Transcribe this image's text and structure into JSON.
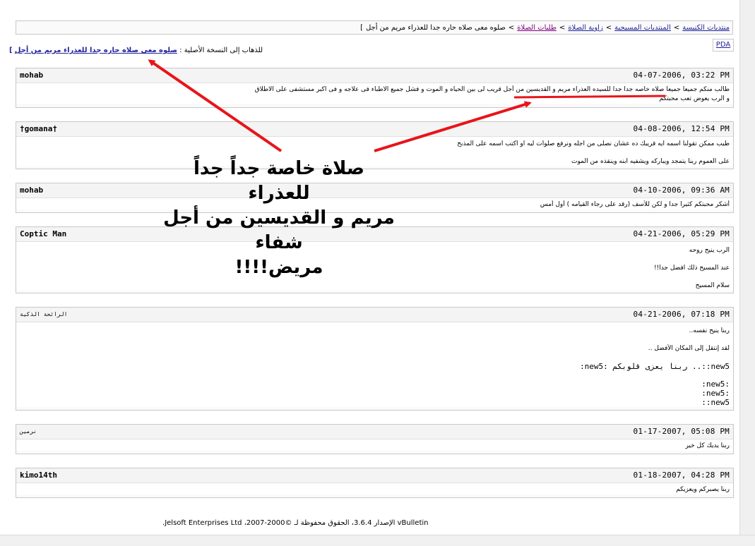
{
  "navbar": {
    "crumbs": [
      "منتديات الكنيسة",
      "المنتديات المسيحية",
      "زاوية الصلاة",
      "طلبات الصلاة"
    ],
    "current": "صلوه معى صلاه حاره جدا للعذراء مريم من أجل",
    "end": "]"
  },
  "pda": "PDA",
  "original": {
    "label": "للذهاب إلى النسخة الأصلية :",
    "link": "صلوه معى صلاه حاره جدا للعذراء مريم من أجل",
    "bracket": "]"
  },
  "posts": [
    {
      "author": "mohab",
      "date": "04-07-2006, 03:22 PM",
      "lines": [
        "طالب منكم جميعا جميعا صلاه خاصه جدا جدا للسيده العذراء مريم و القديسين من أجل قريب لى بين الحياه و الموت و فشل جميع الاطباء فى علاجه و فى اكبر مستشفى على الاطلاق",
        "و الرب يعوض تعب محبتكم"
      ]
    },
    {
      "author": "†gomana†",
      "date": "04-08-2006, 12:54 PM",
      "lines": [
        "طيب ممكن تقولنا اسمه ايه قريبك ده عشان نصلى من اجله ونرفع صلوات ليه او اكتب اسمه على المذبح",
        "",
        "على العموم ربنا يتمجد ويباركه ويشفيه ابنه وينقذه من الموت"
      ]
    },
    {
      "author": "mohab",
      "date": "04-10-2006, 09:36 AM",
      "lines": [
        "أشكر محبتكم كثيرا جدا و لكن للأسف (رقد على رجاء القيامه ) أول أمس"
      ]
    },
    {
      "author": "Coptic Man",
      "date": "04-21-2006, 05:29 PM",
      "lines": [
        "الرب ينيح روحه",
        "",
        "عند المسيح ذلك افضل جدا!!",
        "",
        "سلام المسيح"
      ]
    },
    {
      "author": "الرائحة الذكية",
      "date": "04-21-2006, 07:18 PM",
      "lines": [
        "ربنا ينيح نفسه..",
        "",
        "لقد إنتقل إلى المكان الأفضل ..",
        "",
        ":new5: ربنا يعزى قلوبكم ..::new5",
        "",
        "",
        ":new5:",
        ":new5:",
        "::new5"
      ]
    },
    {
      "author": "نرمين",
      "date": "01-17-2007, 05:08 PM",
      "lines": [
        "ربنا يديك كل خير"
      ]
    },
    {
      "author": "kimo14th",
      "date": "01-18-2007, 04:28 PM",
      "lines": [
        "ربنا يصبركم ويعزيكم"
      ]
    }
  ],
  "caption": {
    "line1": "صلاة خاصة جداً  جداً للعذراء",
    "line2": "مريم و القديسين من أجل شفاء",
    "line3": "مريض!!!!"
  },
  "footer": "vBulletin الإصدار 3.6.4، الحقوق محفوظة لـ ©2000-2007، Jelsoft Enterprises Ltd.",
  "colors": {
    "link": "#22229c",
    "visited": "#800080",
    "annotation_arrow": "#e8141a"
  }
}
